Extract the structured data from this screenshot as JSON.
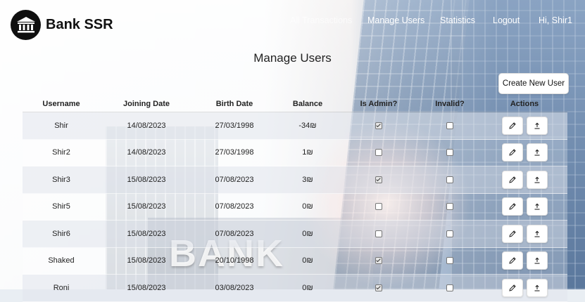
{
  "app": {
    "name": "Bank SSR"
  },
  "nav": {
    "all_transactions": "All Transactions",
    "manage_users": "Manage Users",
    "statistics": "Statistics",
    "logout": "Logout",
    "greeting": "Hi, Shir1"
  },
  "page": {
    "title": "Manage Users",
    "create_button": "Create New User"
  },
  "table": {
    "headers": [
      "Username",
      "Joining Date",
      "Birth Date",
      "Balance",
      "Is Admin?",
      "Invalid?",
      "Actions"
    ],
    "rows": [
      {
        "username": "Shir",
        "joining": "14/08/2023",
        "birth": "27/03/1998",
        "balance": "-34₪",
        "is_admin": true,
        "invalid": false
      },
      {
        "username": "Shir2",
        "joining": "14/08/2023",
        "birth": "27/03/1998",
        "balance": "1₪",
        "is_admin": false,
        "invalid": false
      },
      {
        "username": "Shir3",
        "joining": "15/08/2023",
        "birth": "07/08/2023",
        "balance": "3₪",
        "is_admin": true,
        "invalid": false
      },
      {
        "username": "Shir5",
        "joining": "15/08/2023",
        "birth": "07/08/2023",
        "balance": "0₪",
        "is_admin": false,
        "invalid": false
      },
      {
        "username": "Shir6",
        "joining": "15/08/2023",
        "birth": "07/08/2023",
        "balance": "0₪",
        "is_admin": false,
        "invalid": false
      },
      {
        "username": "Shaked",
        "joining": "15/08/2023",
        "birth": "20/10/1998",
        "balance": "0₪",
        "is_admin": true,
        "invalid": false
      },
      {
        "username": "Roni",
        "joining": "15/08/2023",
        "birth": "03/08/2023",
        "balance": "0₪",
        "is_admin": true,
        "invalid": false
      }
    ],
    "actions": {
      "edit_icon": "pencil-icon",
      "upload_icon": "upload-icon"
    }
  },
  "background": {
    "watermark": "BANK"
  }
}
